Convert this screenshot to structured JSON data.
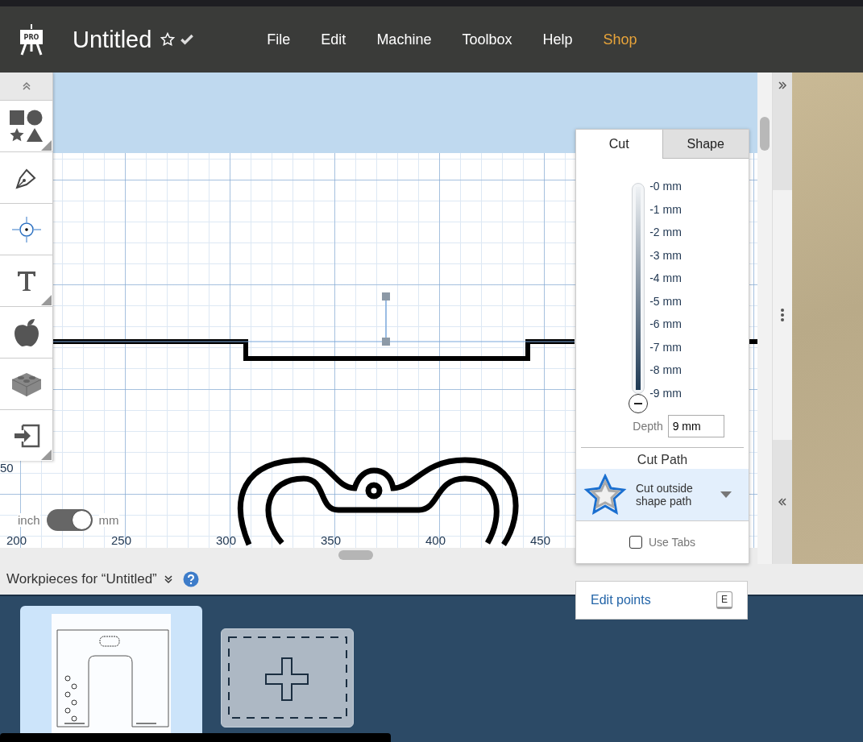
{
  "header": {
    "logo_text": "PRO",
    "title": "Untitled",
    "menu": [
      {
        "label": "File",
        "kind": "menu"
      },
      {
        "label": "Edit",
        "kind": "menu"
      },
      {
        "label": "Machine",
        "kind": "menu"
      },
      {
        "label": "Toolbox",
        "kind": "menu"
      },
      {
        "label": "Help",
        "kind": "menu"
      },
      {
        "label": "Shop",
        "kind": "shop"
      }
    ]
  },
  "canvas": {
    "edge_label": "50",
    "ruler_labels": [
      "200",
      "250",
      "300",
      "350",
      "400",
      "450"
    ]
  },
  "unit_toggle": {
    "left": "inch",
    "right": "mm",
    "on": true
  },
  "panel": {
    "tabs": [
      {
        "label": "Cut",
        "selected": true
      },
      {
        "label": "Shape",
        "selected": false
      }
    ],
    "depth_scale": [
      "-0 mm",
      "-1 mm",
      "-2 mm",
      "-3 mm",
      "-4 mm",
      "-5 mm",
      "-6 mm",
      "-7 mm",
      "-8 mm",
      "-9 mm"
    ],
    "depth_slider": {
      "level": 1
    },
    "depth": {
      "label": "Depth",
      "value": "9 mm"
    },
    "cut_path": {
      "title": "Cut Path",
      "option": "Cut outside shape path"
    },
    "use_tabs": {
      "label": "Use Tabs",
      "checked": false
    }
  },
  "edit_points": {
    "label": "Edit points",
    "key": "E"
  },
  "workpieces": {
    "title": "Workpieces for “Untitled”",
    "items": [
      {
        "kind": "design",
        "selected": true
      },
      {
        "kind": "add",
        "selected": false
      }
    ]
  }
}
